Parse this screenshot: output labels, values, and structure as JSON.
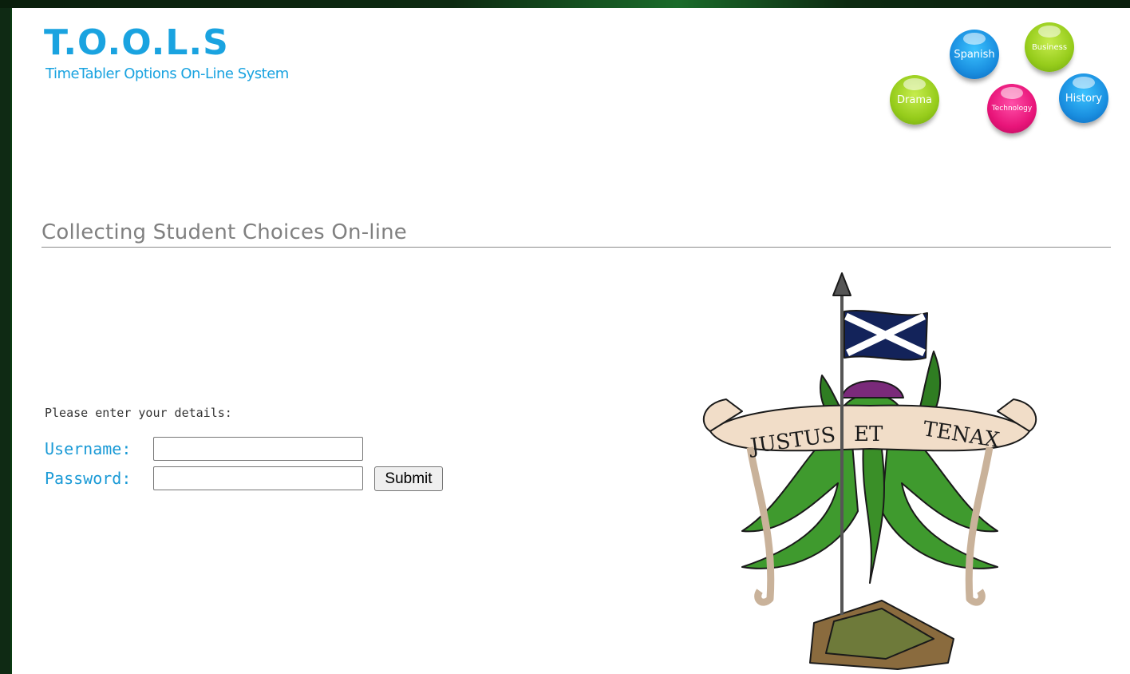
{
  "header": {
    "logo_title": "T.O.O.L.S",
    "logo_subtitle": "TimeTabler Options On-Line System"
  },
  "bubbles": [
    {
      "name": "spanish",
      "label": "Spanish",
      "color": "blue"
    },
    {
      "name": "business",
      "label": "Business",
      "color": "green"
    },
    {
      "name": "drama",
      "label": "Drama",
      "color": "green"
    },
    {
      "name": "technology",
      "label": "Technology",
      "color": "pink"
    },
    {
      "name": "history",
      "label": "History",
      "color": "blue"
    }
  ],
  "main": {
    "heading": "Collecting Student Choices On-line",
    "prompt": "Please enter your details:"
  },
  "login": {
    "username_label": "Username:",
    "username_value": "",
    "password_label": "Password:",
    "password_value": "",
    "submit_label": "Submit"
  },
  "crest": {
    "motto_words": [
      "JUSTUS",
      "ET",
      "TENAX"
    ]
  },
  "colors": {
    "brand_blue": "#1aa3e0",
    "heading_gray": "#808080",
    "frame_dark_green": "#0f2a14"
  }
}
